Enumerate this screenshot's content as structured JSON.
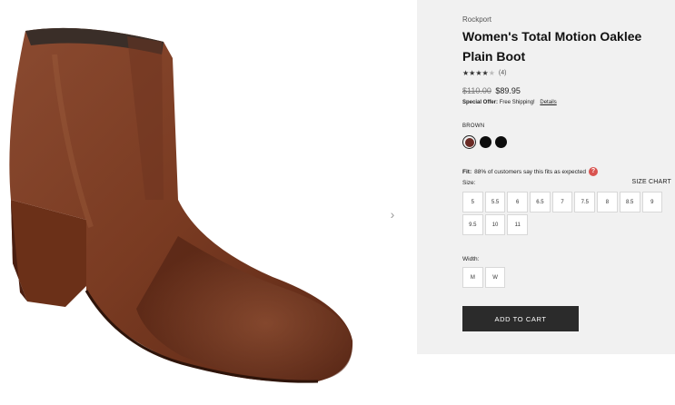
{
  "gallery": {
    "next_icon": "chevron-right-icon",
    "next_glyph": "›"
  },
  "product": {
    "brand": "Rockport",
    "title": "Women's Total Motion Oaklee Plain Boot",
    "rating": 4,
    "rating_max": 5,
    "review_count": "(4)",
    "price_old": "$110.00",
    "price_new": "$89.95",
    "offer_label": "Special Offer:",
    "offer_text": "Free Shipping!",
    "offer_link": "Details",
    "color_label": "BROWN",
    "swatches": [
      {
        "name": "Brown",
        "color": "#6a2a24",
        "selected": true
      },
      {
        "name": "Black",
        "color": "#0d0d0d",
        "selected": false
      },
      {
        "name": "Black",
        "color": "#0d0d0d",
        "selected": false
      }
    ],
    "fit_label": "Fit:",
    "fit_text": "88% of customers say this fits as expected",
    "fit_help_glyph": "?",
    "size_label": "Size:",
    "size_chart_link": "SIZE CHART",
    "sizes": [
      "5",
      "5.5",
      "6",
      "6.5",
      "7",
      "7.5",
      "8",
      "8.5",
      "9",
      "9.5",
      "10",
      "11"
    ],
    "width_label": "Width:",
    "widths": [
      "M",
      "W"
    ],
    "add_to_cart": "ADD TO CART"
  }
}
